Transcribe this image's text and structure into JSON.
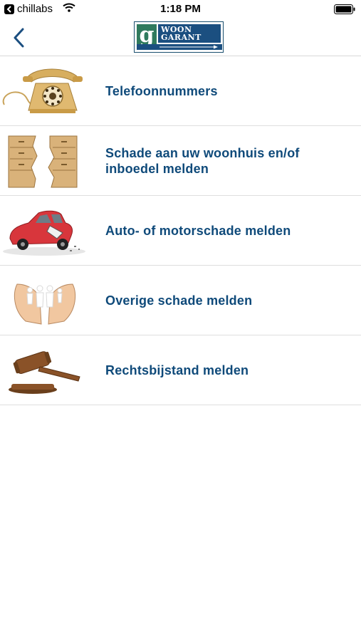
{
  "status_bar": {
    "carrier": "chillabs",
    "time": "1:18 PM"
  },
  "nav": {
    "logo": {
      "letter": "g",
      "line1": "WOON",
      "line2": "GARANT"
    }
  },
  "colors": {
    "label_text": "#0f4a7a",
    "logo_green": "#2f7a5d",
    "logo_blue": "#1b4f80",
    "divider": "#dedede"
  },
  "menu": {
    "items": [
      {
        "label": "Telefoonnummers",
        "icon": "telephone-icon"
      },
      {
        "label": "Schade aan uw woonhuis en/of inboedel melden",
        "icon": "broken-cabinet-icon"
      },
      {
        "label": "Auto- of motorschade melden",
        "icon": "damaged-car-icon"
      },
      {
        "label": "Overige schade melden",
        "icon": "hands-family-icon"
      },
      {
        "label": "Rechtsbijstand melden",
        "icon": "gavel-icon"
      }
    ]
  }
}
